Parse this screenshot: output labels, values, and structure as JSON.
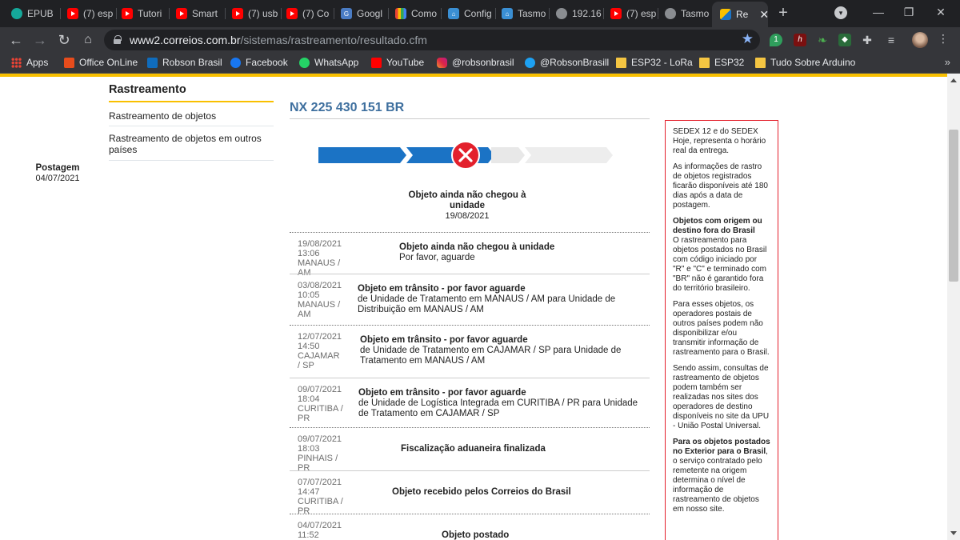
{
  "browser": {
    "tabs": [
      {
        "label": "EPUB",
        "icon": "teal-circle-icon"
      },
      {
        "label": "(7) esp",
        "icon": "youtube-icon"
      },
      {
        "label": "Tutori",
        "icon": "youtube-icon"
      },
      {
        "label": "Smart",
        "icon": "youtube-icon"
      },
      {
        "label": "(7) usb",
        "icon": "youtube-icon"
      },
      {
        "label": "(7) Co",
        "icon": "youtube-icon"
      },
      {
        "label": "Googl",
        "icon": "google-translate-icon"
      },
      {
        "label": "Como",
        "icon": "grid-icon"
      },
      {
        "label": "Config",
        "icon": "tasmota-icon"
      },
      {
        "label": "Tasmo",
        "icon": "tasmota-icon"
      },
      {
        "label": "192.16",
        "icon": "globe-icon"
      },
      {
        "label": "(7) esp",
        "icon": "youtube-icon"
      },
      {
        "label": "Tasmo",
        "icon": "globe-icon"
      },
      {
        "label": "Re",
        "icon": "correios-icon"
      }
    ],
    "url_host": "www2.correios.com.br",
    "url_path": "/sistemas/rastreamento/resultado.cfm",
    "bookmarks": [
      {
        "label": "Apps"
      },
      {
        "label": "Office OnLine"
      },
      {
        "label": "Robson Brasil"
      },
      {
        "label": "Facebook"
      },
      {
        "label": "WhatsApp"
      },
      {
        "label": "YouTube"
      },
      {
        "label": "@robsonbrasil"
      },
      {
        "label": "@RobsonBrasill"
      },
      {
        "label": "ESP32 - LoRa"
      },
      {
        "label": "ESP32"
      },
      {
        "label": "Tudo Sobre Arduino"
      }
    ],
    "bookmarks_more": "»",
    "ext_badge": "1"
  },
  "sidebar": {
    "title": "Rastreamento",
    "items": [
      {
        "label": "Rastreamento de objetos"
      },
      {
        "label": "Rastreamento de objetos em outros países"
      }
    ]
  },
  "tracking": {
    "code": "NX 225 430 151 BR",
    "colors": {
      "done": "#1b73c5",
      "pending": "#e8e8e8",
      "fail": "#e3202c"
    },
    "steps": [
      {
        "title": "Postagem",
        "date": "04/07/2021"
      },
      {
        "title": "Objeto ainda não chegou à unidade",
        "date": "19/08/2021"
      }
    ],
    "events": [
      {
        "date": "19/08/2021",
        "time": "13:06",
        "place": "MANAUS / AM",
        "title": "Objeto ainda não chegou à unidade",
        "detail": "Por favor, aguarde"
      },
      {
        "date": "03/08/2021",
        "time": "10:05",
        "place": "MANAUS / AM",
        "title": "Objeto em trânsito - por favor aguarde",
        "detail": "de Unidade de Tratamento em MANAUS / AM para Unidade de Distribuição em MANAUS / AM"
      },
      {
        "date": "12/07/2021",
        "time": "14:50",
        "place": "CAJAMAR / SP",
        "title": "Objeto em trânsito - por favor aguarde",
        "detail": "de Unidade de Tratamento em CAJAMAR / SP para Unidade de Tratamento em MANAUS / AM"
      },
      {
        "date": "09/07/2021",
        "time": "18:04",
        "place": "CURITIBA / PR",
        "title": "Objeto em trânsito - por favor aguarde",
        "detail": "de Unidade de Logística Integrada em CURITIBA / PR para Unidade de Tratamento em CAJAMAR / SP"
      },
      {
        "date": "09/07/2021",
        "time": "18:03",
        "place": "PINHAIS / PR",
        "title": "Fiscalização aduaneira finalizada",
        "detail": ""
      },
      {
        "date": "07/07/2021",
        "time": "14:47",
        "place": "CURITIBA / PR",
        "title": "Objeto recebido pelos Correios do Brasil",
        "detail": ""
      },
      {
        "date": "04/07/2021",
        "time": "11:52",
        "place": "",
        "title": "Objeto postado",
        "detail": ""
      }
    ]
  },
  "infobox": {
    "p1": "SEDEX 12 e do SEDEX Hoje, representa o horário real da entrega.",
    "p2": "As informações de rastro de objetos registrados ficarão disponíveis até 180 dias após a data de postagem.",
    "h1": "Objetos com origem ou destino fora do Brasil",
    "p3": "O rastreamento para objetos postados no Brasil com código iniciado por \"R\" e \"C\" e terminado com \"BR\" não é garantido fora do território brasileiro.",
    "p4": "Para esses objetos, os operadores postais de outros países podem não disponibilizar e/ou transmitir informação de rastreamento para o Brasil.",
    "p5": "Sendo assim, consultas de rastreamento de objetos podem também ser realizadas nos sites dos operadores de destino disponíveis no site da UPU - União Postal Universal.",
    "h2": "Para os objetos postados no Exterior para o Brasil",
    "p6": ", o serviço contratado pelo remetente na origem determina o nível de informação de rastreamento de objetos em nosso site."
  }
}
